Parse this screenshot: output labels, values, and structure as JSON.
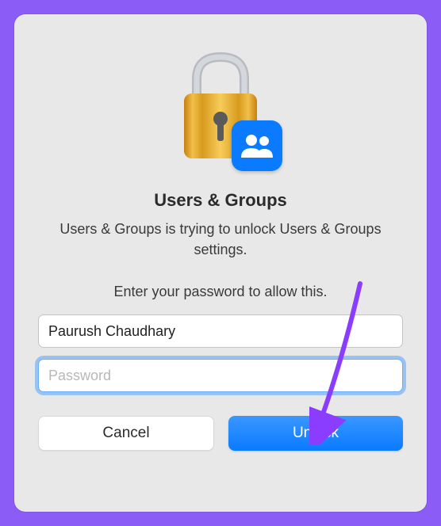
{
  "dialog": {
    "title": "Users & Groups",
    "subtitle": "Users & Groups is trying to unlock Users & Groups settings.",
    "instruction": "Enter your password to allow this.",
    "username_value": "Paurush Chaudhary",
    "password_value": "",
    "password_placeholder": "Password",
    "cancel_label": "Cancel",
    "unlock_label": "Unlock"
  },
  "icons": {
    "lock": "lock-icon",
    "users_badge": "users-icon"
  },
  "colors": {
    "accent": "#0a7aff",
    "annotation": "#8b3dff"
  }
}
